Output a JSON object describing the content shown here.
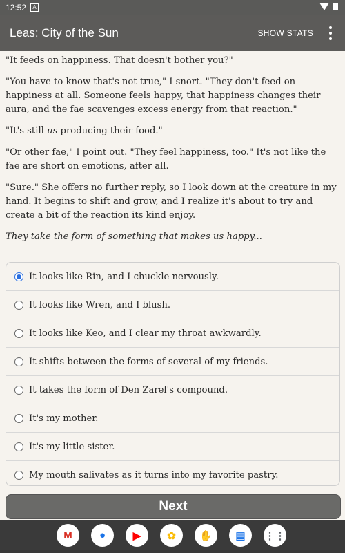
{
  "status": {
    "time": "12:52",
    "notif_icon": "A"
  },
  "appbar": {
    "title": "Leas: City of the Sun",
    "show_stats": "SHOW STATS"
  },
  "story": {
    "p1": "\"It feeds on happiness. That doesn't bother you?\"",
    "p2": "\"You have to know that's not true,\" I snort. \"They don't feed on happiness at all. Someone feels happy, that happiness changes their aura, and the fae scavenges excess energy from that reaction.\"",
    "p3_before": "\"It's still ",
    "p3_em": "us",
    "p3_after": " producing their food.\"",
    "p4": "\"Or other fae,\" I point out. \"They feel happiness, too.\" It's not like the fae are short on emotions, after all.",
    "p5": "\"Sure.\" She offers no further reply, so I look down at the creature in my hand. It begins to shift and grow, and I realize it's about to try and create a bit of the reaction its kind enjoy.",
    "p6": "They take the form of something that makes us happy..."
  },
  "options": [
    {
      "label": "It looks like Rin, and I chuckle nervously.",
      "selected": true
    },
    {
      "label": "It looks like Wren, and I blush.",
      "selected": false
    },
    {
      "label": "It looks like Keo, and I clear my throat awkwardly.",
      "selected": false
    },
    {
      "label": "It shifts between the forms of several of my friends.",
      "selected": false
    },
    {
      "label": "It takes the form of Den Zarel's compound.",
      "selected": false
    },
    {
      "label": "It's my mother.",
      "selected": false
    },
    {
      "label": "It's my little sister.",
      "selected": false
    },
    {
      "label": "My mouth salivates as it turns into my favorite pastry.",
      "selected": false
    }
  ],
  "next_label": "Next",
  "dock": {
    "apps": [
      {
        "icon": "gmail-icon",
        "glyph": "M",
        "color": "#d93025"
      },
      {
        "icon": "chrome-icon",
        "glyph": "●",
        "color": "#1a73e8"
      },
      {
        "icon": "youtube-icon",
        "glyph": "▶",
        "color": "#ff0000"
      },
      {
        "icon": "photos-icon",
        "glyph": "✿",
        "color": "#fbbc04"
      },
      {
        "icon": "game-app-icon",
        "glyph": "✋",
        "color": "#7a3b2e"
      },
      {
        "icon": "messages-icon",
        "glyph": "▤",
        "color": "#1a73e8"
      },
      {
        "icon": "app-drawer-icon",
        "glyph": "⋮⋮",
        "color": "#5f6368"
      }
    ]
  }
}
